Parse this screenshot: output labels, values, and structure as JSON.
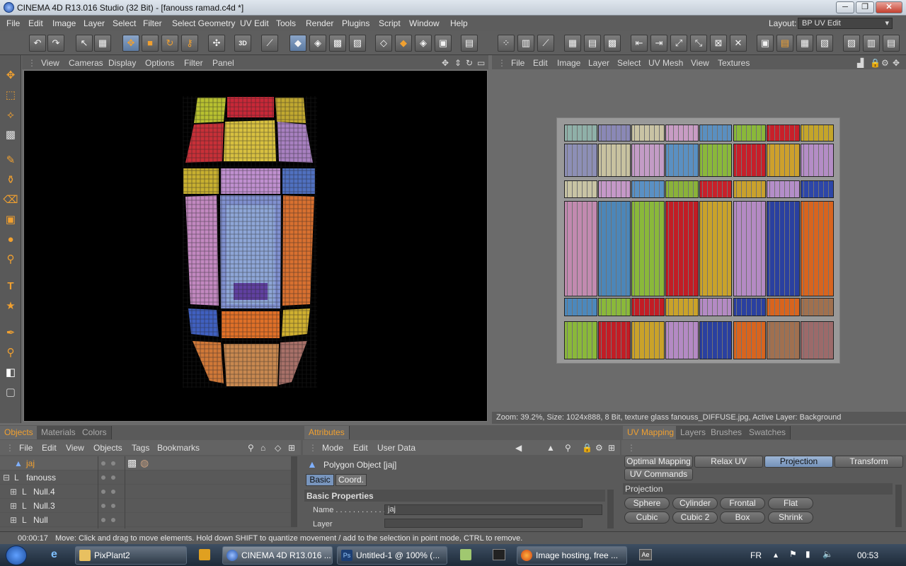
{
  "window": {
    "title": "CINEMA 4D R13.016 Studio (32 Bit) - [fanouss ramad.c4d *]",
    "min": "─",
    "max": "❐",
    "close": "✕"
  },
  "menu": [
    "File",
    "Edit",
    "Image",
    "Layer",
    "Select",
    "Filter",
    "Select Geometry",
    "UV Edit",
    "Tools",
    "Render",
    "Plugins",
    "Script",
    "Window",
    "Help"
  ],
  "layout": {
    "label": "Layout:",
    "value": "BP UV Edit"
  },
  "viewport_menu": [
    "View",
    "Cameras",
    "Display",
    "Options",
    "Filter",
    "Panel"
  ],
  "uv_menu": [
    "File",
    "Edit",
    "Image",
    "Layer",
    "Select",
    "UV Mesh",
    "View",
    "Textures"
  ],
  "uv_status": "Zoom: 39.2%, Size: 1024x888, 8 Bit, texture glass fanouss_DIFFUSE.jpg, Active Layer: Background",
  "objects_tabs": [
    "Objects",
    "Materials",
    "Colors"
  ],
  "objects_menu": [
    "File",
    "Edit",
    "View",
    "Objects",
    "Tags",
    "Bookmarks"
  ],
  "objects": [
    {
      "name": "jaj",
      "indent": 0,
      "active": true
    },
    {
      "name": "fanouss",
      "indent": 0,
      "active": false
    },
    {
      "name": "Null.4",
      "indent": 1,
      "active": false
    },
    {
      "name": "Null.3",
      "indent": 1,
      "active": false
    },
    {
      "name": "Null",
      "indent": 1,
      "active": false
    }
  ],
  "attributes": {
    "tab": "Attributes",
    "menu": [
      "Mode",
      "Edit",
      "User Data"
    ],
    "object_label": "Polygon Object [jaj]",
    "subtabs": [
      "Basic",
      "Coord."
    ],
    "section": "Basic Properties",
    "name_label": "Name . . . . . . . . . . . .",
    "name_value": "jaj",
    "layer_label": "Layer"
  },
  "uv_panel": {
    "tabs": [
      "UV Mapping",
      "Layers",
      "Brushes",
      "Swatches"
    ],
    "buttons": [
      "Optimal Mapping",
      "Relax UV",
      "Projection",
      "Transform",
      "UV Commands"
    ],
    "selected": "Projection",
    "section": "Projection",
    "proj_buttons": [
      "Sphere",
      "Cylinder",
      "Frontal",
      "Flat",
      "Cubic",
      "Cubic 2",
      "Box",
      "Shrink"
    ]
  },
  "status": {
    "time": "00:00:17",
    "message": "Move: Click and drag to move elements. Hold down SHIFT to quantize movement / add to the selection in point mode, CTRL to remove."
  },
  "taskbar": {
    "items": [
      "PixPlant2",
      "CINEMA 4D R13.016 ...",
      "Untitled-1 @ 100% (...",
      "Image hosting, free ..."
    ],
    "lang": "FR",
    "clock": "00:53"
  },
  "colors": {
    "accent": "#f0a030",
    "panel": "#5a5a5a",
    "viewport_bg": "#000000"
  },
  "texture_rows": [
    [
      "#8fb0a8",
      "#8a88b6",
      "#c9c3a4",
      "#c89cc4",
      "#5a8fc0",
      "#8ab83a",
      "#c8202a",
      "#c4a52a"
    ],
    [
      "#8d8fb6",
      "#c8c2a0",
      "#c39cc6",
      "#5a90c2",
      "#8ab83a",
      "#c61f2a",
      "#cda02c",
      "#b48dc6"
    ],
    [
      "#c8c4a4",
      "#c598c8",
      "#5a90c4",
      "#8ab23a",
      "#c8202a",
      "#c9a12c",
      "#b48ec9",
      "#2d46a8"
    ],
    [
      "#c28ab0",
      "#4c86b8",
      "#8ab83a",
      "#c21d25",
      "#c9a22a",
      "#b48ac4",
      "#2a40a0",
      "#d8641e"
    ],
    [
      "#4c88bc",
      "#8ab83a",
      "#c21d25",
      "#c9a22a",
      "#b48ac4",
      "#2a40a0",
      "#d8641e",
      "#a0704e"
    ],
    [
      "#8ab83a",
      "#c21d25",
      "#c9a22a",
      "#b48ac4",
      "#2a40a0",
      "#d8641e",
      "#a07050",
      "#9c6a6a"
    ]
  ]
}
